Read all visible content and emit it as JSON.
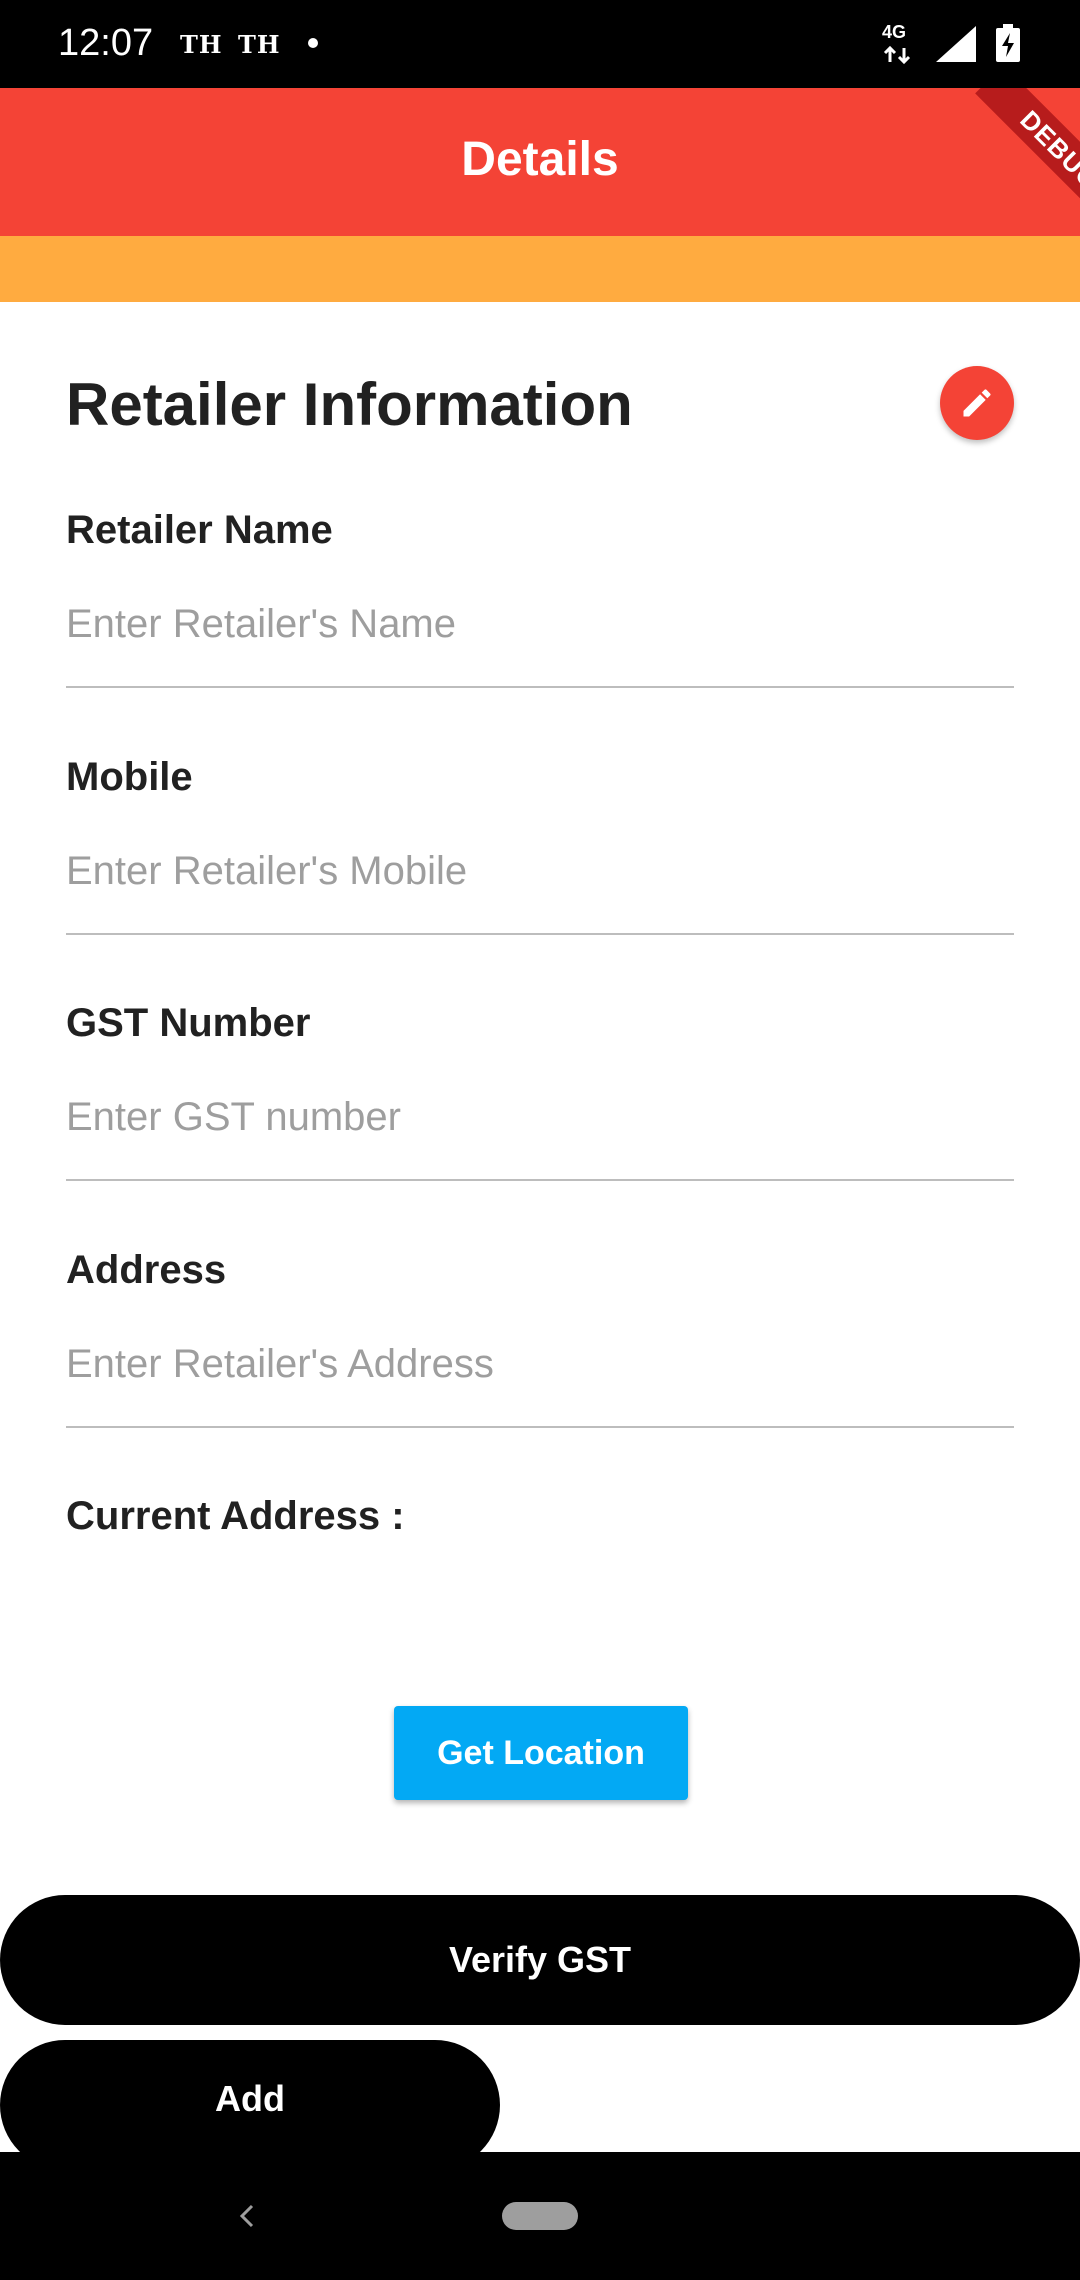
{
  "status_bar": {
    "time": "12:07",
    "carriers": [
      "TH",
      "TH"
    ],
    "network_type": "4G"
  },
  "app_bar": {
    "title": "Details",
    "debug_label": "DEBUG",
    "color": "#f44336"
  },
  "accent_strip_color": "#ffab40",
  "form": {
    "section_title": "Retailer Information",
    "edit_icon": "pencil-icon",
    "fields": [
      {
        "label": "Retailer Name",
        "value": "",
        "placeholder": "Enter Retailer's Name"
      },
      {
        "label": "Mobile",
        "value": "",
        "placeholder": "Enter Retailer's Mobile"
      },
      {
        "label": "GST Number",
        "value": "",
        "placeholder": "Enter GST number"
      },
      {
        "label": "Address",
        "value": "",
        "placeholder": "Enter Retailer's Address"
      }
    ],
    "current_address_label": "Current Address :",
    "current_address_value": ""
  },
  "buttons": {
    "get_location": "Get Location",
    "verify_gst": "Verify GST",
    "add": "Add"
  },
  "colors": {
    "primary_button": "#03a9f4",
    "action_button": "#000000"
  },
  "nav_bar": {
    "back_icon": "chevron-left-icon",
    "home_icon": "home-pill-icon"
  }
}
